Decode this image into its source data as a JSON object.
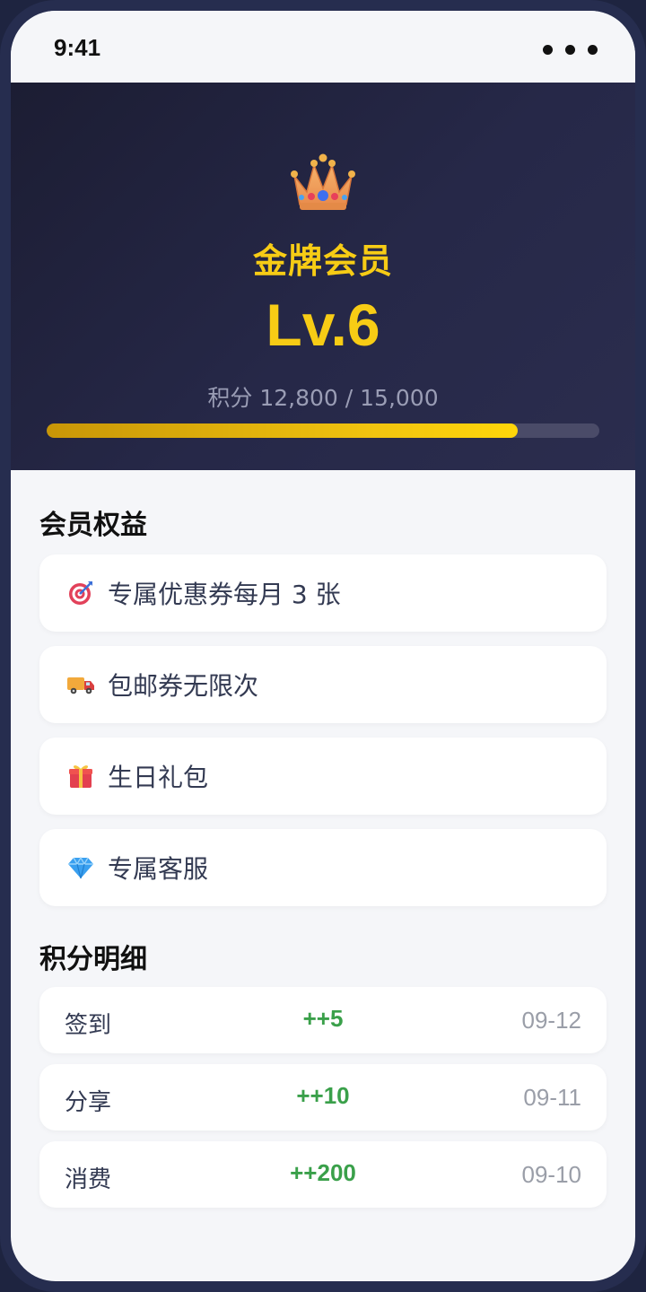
{
  "status_bar": {
    "time": "9:41"
  },
  "membership": {
    "tier": "金牌会员",
    "level": "Lv.6",
    "points_text": "积分 12,800 / 15,000",
    "progress_fraction": 0.853,
    "accent_color": "#f7cc15"
  },
  "benefits": {
    "title": "会员权益",
    "items": [
      {
        "icon": "target-icon",
        "label": "专属优惠券每月 3 张"
      },
      {
        "icon": "delivery-truck-icon",
        "label": "包邮券无限次"
      },
      {
        "icon": "gift-icon",
        "label": "生日礼包"
      },
      {
        "icon": "diamond-icon",
        "label": "专属客服"
      }
    ]
  },
  "points_detail": {
    "title": "积分明细",
    "records": [
      {
        "type": "签到",
        "amount": "++5",
        "date": "09-12"
      },
      {
        "type": "分享",
        "amount": "++10",
        "date": "09-11"
      },
      {
        "type": "消费",
        "amount": "++200",
        "date": "09-10"
      }
    ],
    "amount_color": "#3aa04a"
  }
}
